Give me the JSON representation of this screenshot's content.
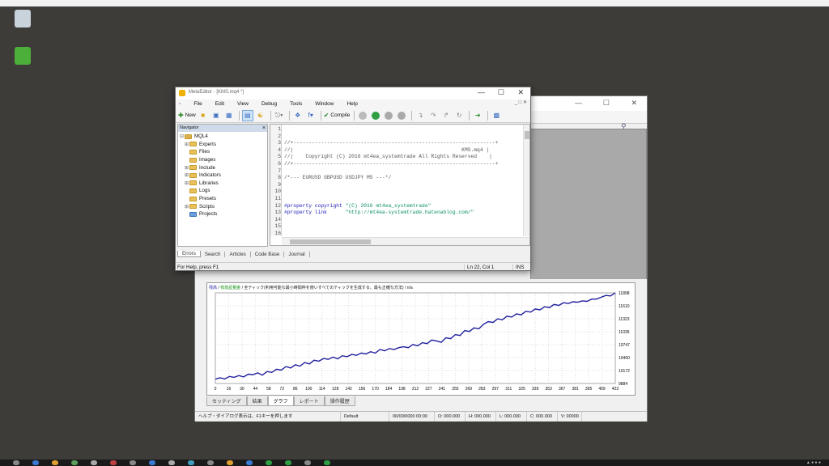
{
  "colors": {
    "desktop": "#3e3c39",
    "equity_line": "#1f1f9e",
    "accent": "#cfdbea"
  },
  "metaeditor": {
    "menu": [
      "File",
      "Edit",
      "View",
      "Debug",
      "Tools",
      "Window",
      "Help"
    ],
    "toolbar": {
      "new_label": "New",
      "compile_label": "Compile"
    },
    "navigator": {
      "title": "Navigator",
      "root": "MQL4",
      "items": [
        {
          "label": "Experts",
          "expandable": true
        },
        {
          "label": "Files",
          "expandable": false
        },
        {
          "label": "Images",
          "expandable": false
        },
        {
          "label": "Include",
          "expandable": true
        },
        {
          "label": "Indicators",
          "expandable": true
        },
        {
          "label": "Libraries",
          "expandable": true
        },
        {
          "label": "Logs",
          "expandable": false
        },
        {
          "label": "Presets",
          "expandable": false
        },
        {
          "label": "Scripts",
          "expandable": true
        },
        {
          "label": "Projects",
          "expandable": false
        }
      ]
    },
    "code": {
      "l3": "//+------------------------------------------------------------------+",
      "l4": "//|                                                       KMS.mq4 |",
      "l5": "//|    Copyright (C) 2016 mt4ea_systemtrade All Rights Reserved    |",
      "l6": "//+------------------------------------------------------------------+",
      "l8": "/*--- EURUSD GBPUSD USDJPY M5 ---*/",
      "l12_kw": "#property copyright ",
      "l12_str": "\"(C) 2016 mt4ea_systemtrade\"",
      "l13_kw": "#property link      ",
      "l13_str": "\"http://mt4ea-systemtrade.hatenablog.com/\""
    },
    "tabs": [
      "Errors",
      "Search",
      "Articles",
      "Code Base",
      "Journal"
    ],
    "status": {
      "help": "For Help, press F1",
      "position": "Ln 22, Col 1",
      "mode": "INS"
    }
  },
  "mt4": {
    "statusbar": [
      "Default",
      "00/00/0000 00:00",
      "O: 000.000",
      "H: 000.000",
      "L: 000.000",
      "C: 000.000",
      "V: 00000"
    ],
    "tester_tabs": [
      "グラフ",
      "レポート",
      "操作履歴"
    ]
  },
  "chart_data": {
    "type": "line",
    "x_ticks": [
      "0",
      "16",
      "30",
      "44",
      "58",
      "72",
      "86",
      "100",
      "114",
      "128",
      "142",
      "156",
      "170",
      "184",
      "198",
      "212",
      "227",
      "241",
      "255",
      "269",
      "283",
      "297",
      "311",
      "325",
      "339",
      "353",
      "367",
      "381",
      "395",
      "409",
      "423"
    ],
    "y_ticks": [
      "11898",
      "11610",
      "11323",
      "11035",
      "10747",
      "10460",
      "10172",
      "9884"
    ],
    "ylim": [
      9884,
      11898
    ],
    "series": [
      {
        "values": [
          9980,
          10010,
          9985,
          10040,
          10020,
          10060,
          10030,
          10090,
          10080,
          10120,
          10070,
          10150,
          10130,
          10200,
          10180,
          10260,
          10230,
          10300,
          10270,
          10350,
          10320,
          10400,
          10380,
          10440,
          10420,
          10470,
          10430,
          10500,
          10480,
          10530,
          10510,
          10560,
          10540,
          10590,
          10560,
          10640,
          10610,
          10660,
          10640,
          10680,
          10700,
          10680,
          10750,
          10720,
          10790,
          10770,
          10850,
          10830,
          10800,
          10900,
          10880,
          10970,
          10950,
          11060,
          11040,
          11120,
          11100,
          11200,
          11260,
          11240,
          11320,
          11300,
          11380,
          11360,
          11430,
          11410,
          11490,
          11470,
          11540,
          11520,
          11590,
          11570,
          11640,
          11620,
          11680,
          11660,
          11700,
          11690,
          11720,
          11710,
          11760,
          11760,
          11800,
          11840,
          11830,
          11900
        ]
      }
    ]
  }
}
